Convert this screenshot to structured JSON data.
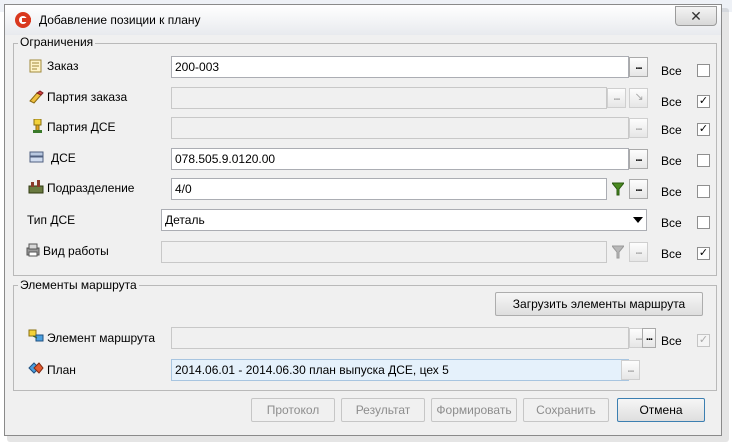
{
  "window": {
    "title": "Добавление позиции к плану",
    "close_glyph": "✕"
  },
  "restrictions": {
    "title": "Ограничения",
    "all_label": "Все",
    "rows": [
      {
        "label": "Заказ",
        "icon": "order-icon",
        "value": "200-003",
        "enabled": true,
        "all_checked": false
      },
      {
        "label": "Партия заказа",
        "icon": "order-batch-icon",
        "value": "",
        "enabled": false,
        "all_checked": true
      },
      {
        "label": "Партия ДСЕ",
        "icon": "part-batch-icon",
        "value": "",
        "enabled": false,
        "all_checked": true
      },
      {
        "label": "ДСЕ",
        "icon": "part-icon",
        "value": "078.505.9.0120.00",
        "enabled": true,
        "all_checked": false
      },
      {
        "label": "Подразделение",
        "icon": "department-icon",
        "value": "4/0",
        "enabled": true,
        "all_checked": false
      },
      {
        "label": "Тип ДСЕ",
        "icon": "",
        "value": "Деталь",
        "enabled": true,
        "all_checked": false
      },
      {
        "label": "Вид работы",
        "icon": "work-type-icon",
        "value": "",
        "enabled": false,
        "all_checked": true
      }
    ],
    "ellipsis": "..."
  },
  "route": {
    "title": "Элементы маршрута",
    "load_button": "Загрузить элементы маршрута",
    "element_label": "Элемент маршрута",
    "element_value": "",
    "element_all_checked": true,
    "plan_label": "План",
    "plan_value": "2014.06.01 - 2014.06.30 план выпуска ДСЕ, цех 5"
  },
  "footer": {
    "buttons": [
      {
        "label": "Протокол",
        "enabled": false
      },
      {
        "label": "Результат",
        "enabled": false
      },
      {
        "label": "Формировать",
        "enabled": false
      },
      {
        "label": "Сохранить",
        "enabled": false
      },
      {
        "label": "Отмена",
        "enabled": true
      }
    ]
  },
  "colors": {
    "accent": "#d9381e",
    "plan_field_bg": "#e5f1fb"
  }
}
